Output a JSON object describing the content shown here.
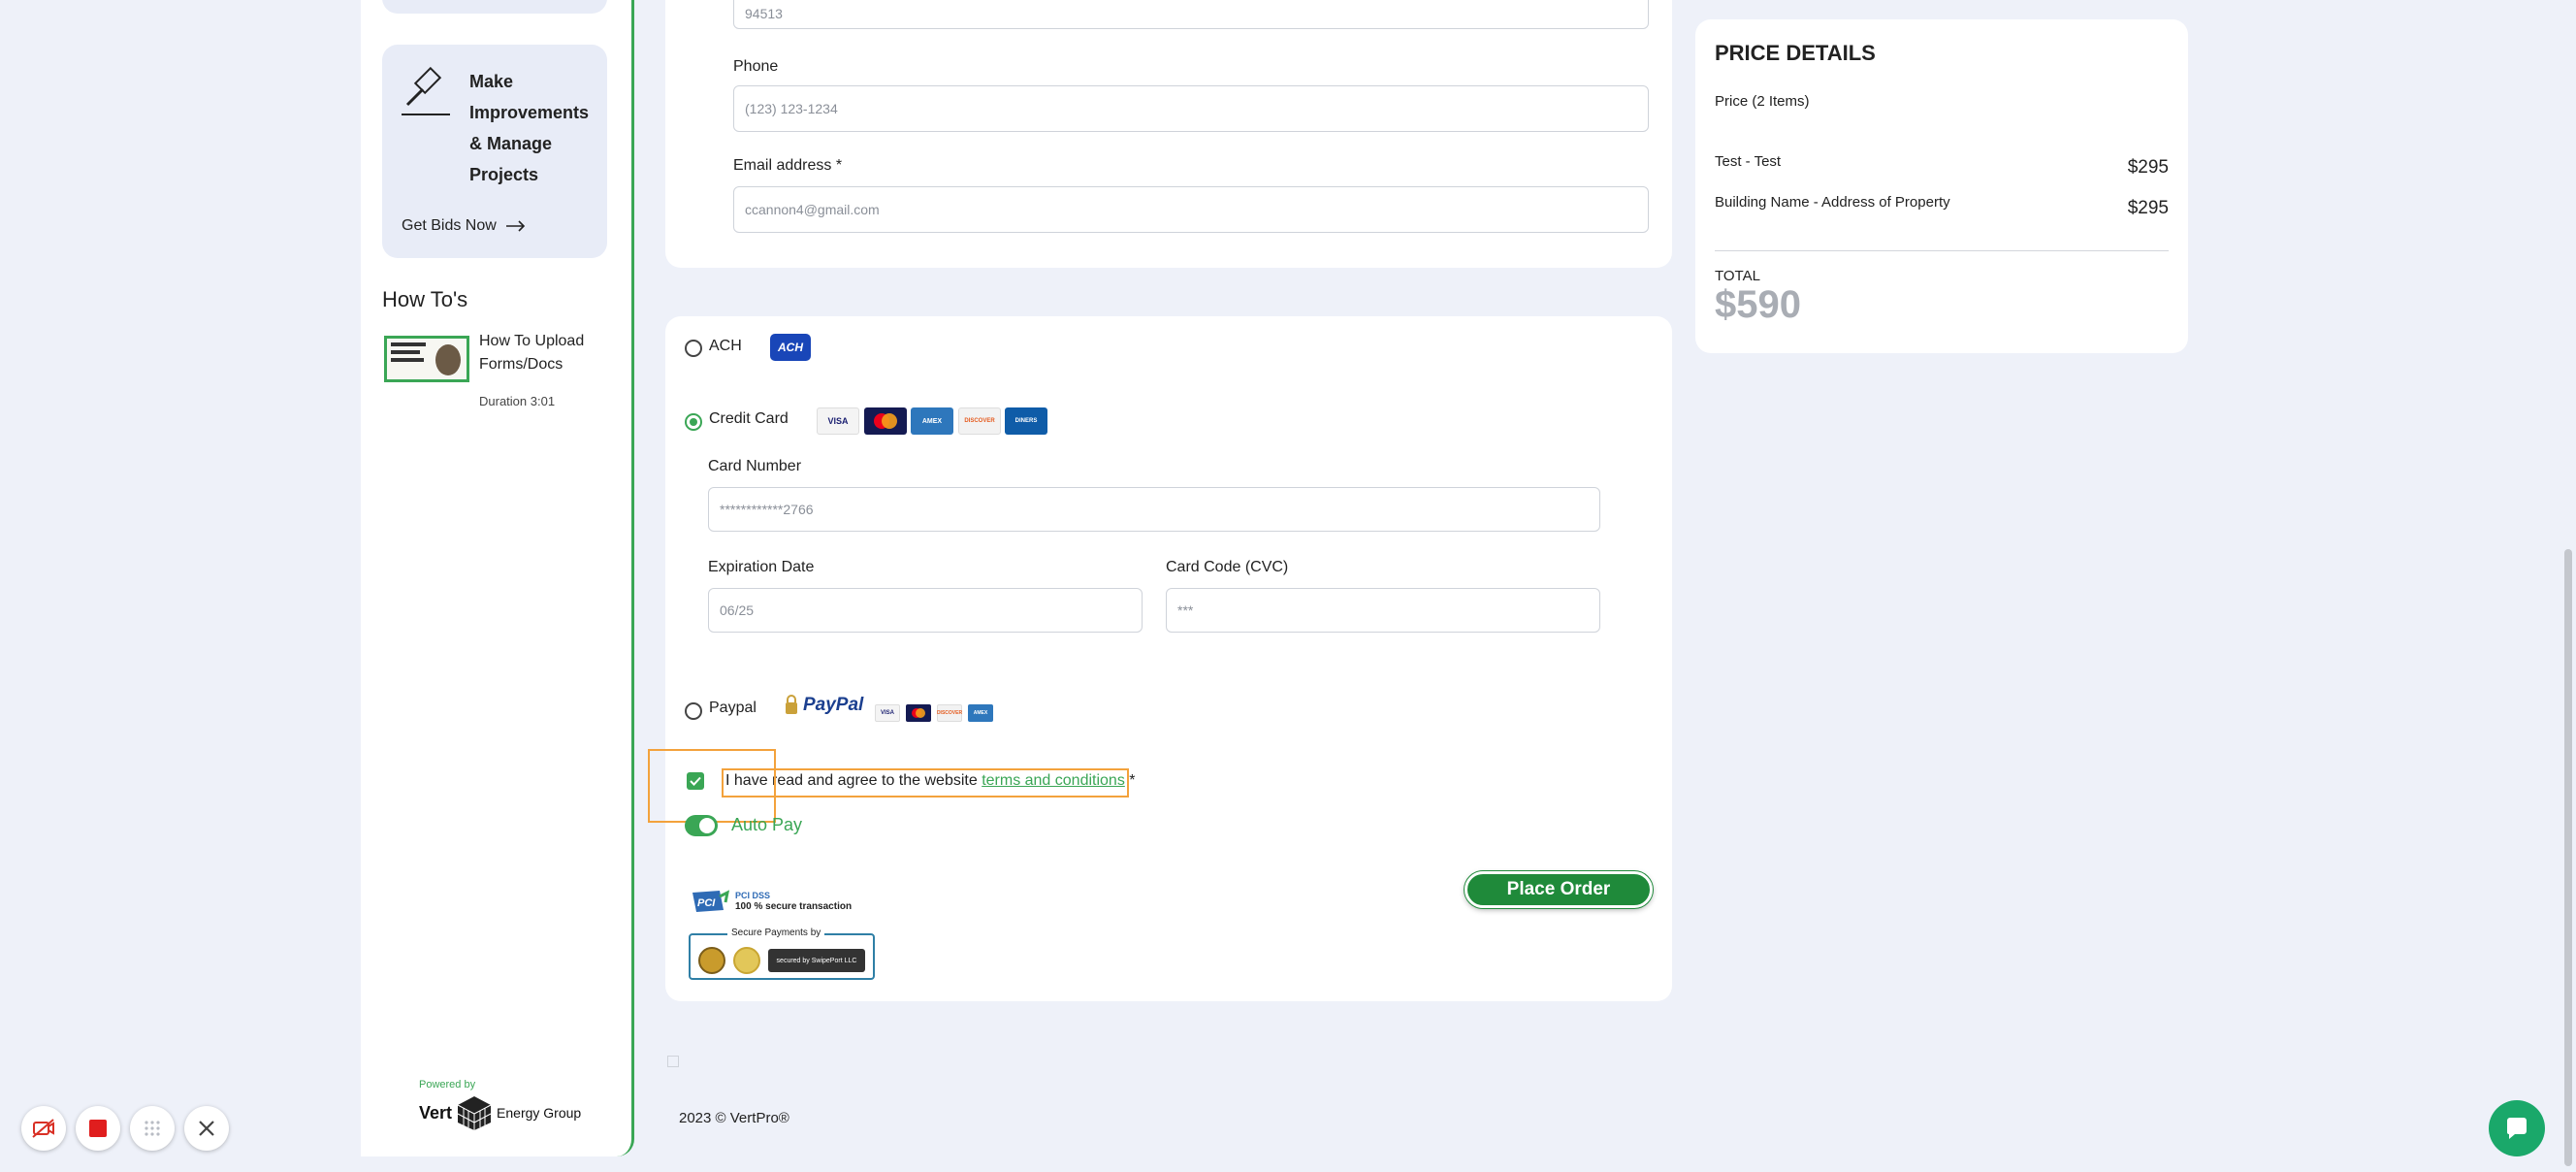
{
  "sidebar": {
    "card_title": "Make Improvements & Manage Projects",
    "get_bids": "Get Bids Now",
    "howtos_title": "How To's",
    "howto_item": {
      "title": "How To Upload Forms/Docs",
      "duration": "Duration 3:01"
    },
    "powered_by": "Powered by",
    "brand_vert": "Vert",
    "brand_group": "Energy Group"
  },
  "contact": {
    "zip_value": "94513",
    "phone_label": "Phone",
    "phone_placeholder": "(123) 123-1234",
    "email_label": "Email address *",
    "email_value": "ccannon4@gmail.com"
  },
  "payment": {
    "ach_label": "ACH",
    "ach_logo": "ACH",
    "credit_label": "Credit Card",
    "card_logos": [
      "VISA",
      "MC",
      "AMEX",
      "DISCOVER",
      "DINERS"
    ],
    "card_number_label": "Card Number",
    "card_number_value": "************2766",
    "expiration_label": "Expiration Date",
    "expiration_value": "06/25",
    "cvc_label": "Card Code (CVC)",
    "cvc_value": "***",
    "paypal_label": "Paypal",
    "paypal_logo": "PayPal",
    "agree_text": "I have read and agree to the website ",
    "agree_link": "terms and conditions",
    "agree_required": " *",
    "autopay_label": "Auto Pay",
    "place_order": "Place Order",
    "pci_badge": "PCI DSS",
    "pci_text": "100 % secure transaction",
    "secure_label": "Secure Payments by",
    "secure_by": "secured by SwipePort LLC",
    "selected_method": "Credit Card",
    "agree_checked": true,
    "autopay_on": true
  },
  "price": {
    "title": "PRICE DETAILS",
    "subtitle": "Price (2 Items)",
    "items": [
      {
        "label": "Test - Test",
        "value": "$295"
      },
      {
        "label": "Building Name - Address of Property",
        "value": "$295"
      }
    ],
    "total_label": "TOTAL",
    "total_value": "$590"
  },
  "footer": {
    "copyright": "2023 © VertPro®"
  },
  "colors": {
    "accent": "#3aa655",
    "button": "#1f8a3a",
    "background": "#eef1f9",
    "highlight": "#f3a23c"
  },
  "icons": [
    "gavel-icon",
    "arrow-right-icon",
    "check-icon",
    "camera-off-icon",
    "stop-icon",
    "grid-icon",
    "close-icon",
    "chat-icon"
  ]
}
